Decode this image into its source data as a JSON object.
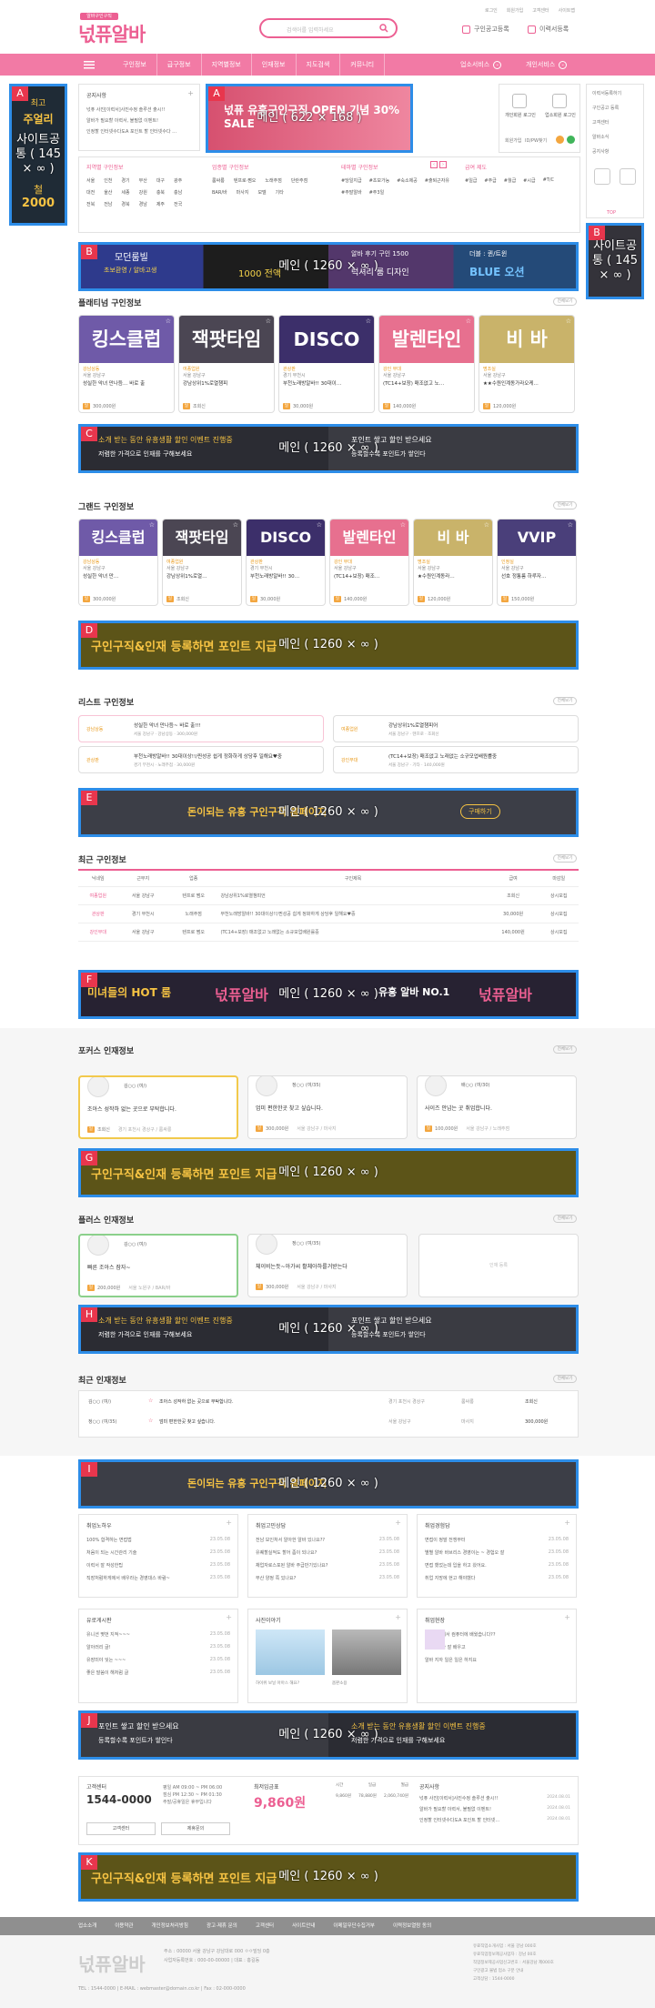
{
  "header": {
    "logo_top": "알바구인구직",
    "logo": "넋퓨알바",
    "top_links": [
      "로그인",
      "회원가입",
      "고객센터",
      "사이트맵"
    ],
    "search_placeholder": "검색어를 입력하세요",
    "register_job": "구인공고등록",
    "register_resume": "이력서등록"
  },
  "nav": {
    "items": [
      "구인정보",
      "급구정보",
      "지역별정보",
      "인재정보",
      "지도검색",
      "커뮤니티"
    ],
    "right1": "업소서비스",
    "right2": "개인서비스"
  },
  "side_left": {
    "lines": [
      "최고",
      "주얼리",
      "철",
      "2000"
    ]
  },
  "side_right_links": [
    "이력서등록하기",
    "구인공고 등록",
    "고객센터",
    "알바소식",
    "공지사항"
  ],
  "top_label": "TOP",
  "notice": {
    "title": "공지사항",
    "items": [
      "넋퓨 사진[이력서]사진수정 솔루션 출시!!",
      "알바가 필요할 이력서, 불필없 이벤트!",
      "인정할 인터넷수다도A 포인트 할 인터넷수다 …"
    ]
  },
  "login_box": {
    "personal": "개인회원 로그인",
    "biz": "업소회원 로그인",
    "links": [
      "회원가입",
      "ID/PW찾기"
    ]
  },
  "filters": [
    {
      "title": "지역별 구인정보",
      "items": [
        "서울",
        "인천",
        "경기",
        "부산",
        "대구",
        "광주",
        "대전",
        "울산",
        "세종",
        "강원",
        "충북",
        "충남",
        "전북",
        "전남",
        "경북",
        "경남",
        "제주",
        "전국"
      ]
    },
    {
      "title": "업종별 구인정보",
      "items": [
        "룸싸롱",
        "텐프로·쩜오",
        "노래주점",
        "단란주점",
        "BAR/바",
        "마사지",
        "모델",
        "기타"
      ]
    },
    {
      "title": "테마별 구인정보",
      "items": [
        "#당일지급",
        "#초보가능",
        "#숙소제공",
        "#출퇴근자유",
        "#주말알바",
        "#주3일"
      ]
    },
    {
      "title": "급여 제도",
      "items": [
        "#일급",
        "#주급",
        "#월급",
        "#시급",
        "#T/C"
      ]
    }
  ],
  "overlays": [
    {
      "label": "A",
      "caption": "사이트공통 ( 145 × ∞ )"
    },
    {
      "label": "A",
      "caption": "메인 ( 622 × 168 )"
    },
    {
      "label": "B",
      "caption": "메인 ( 1260 × ∞ )"
    },
    {
      "label": "B",
      "caption": "사이트공통 ( 145 × ∞ )"
    },
    {
      "label": "C",
      "caption": "메인 ( 1260 × ∞ )"
    },
    {
      "label": "D",
      "caption": "메인 ( 1260 × ∞ )"
    },
    {
      "label": "E",
      "caption": "메인 ( 1260 × ∞ )"
    },
    {
      "label": "F",
      "caption": "메인 ( 1260 × ∞ )"
    },
    {
      "label": "G",
      "caption": "메인 ( 1260 × ∞ )"
    },
    {
      "label": "H",
      "caption": "메인 ( 1260 × ∞ )"
    },
    {
      "label": "I",
      "caption": "메인 ( 1260 × ∞ )"
    },
    {
      "label": "J",
      "caption": "메인 ( 1260 × ∞ )"
    },
    {
      "label": "K",
      "caption": "메인 ( 1260 × ∞ )"
    }
  ],
  "banner_texts": {
    "A_main": "넋퓨 유흥구인구직 OPEN 기념 30% SALE",
    "B_main": [
      "모던룸빌",
      "초보환영 / 알바고생",
      "1000 전액",
      "알바 후기 구인 1500",
      "럭셔리 룸 디자인",
      "더블 : 퀸/트윈",
      "BLUE 오션"
    ],
    "C_main": [
      "소개 받는 동안 유흥생활 할인 이벤트 진행중",
      "저렴한 가격으로 인재를 구해보세요",
      "포인트 쌓고 할인 받으세요",
      "등록할수록 포인트가 쌓인다"
    ],
    "D_main": "구인구직&인재 등록하면 포인트 지급",
    "E_main": [
      "돈이되는 유흥 구인구직 홈페이지",
      "구매하기"
    ],
    "F_main": [
      "미녀들의 HOT 룸",
      "넋퓨알바",
      "유흥 알바 NO.1",
      "넋퓨알바"
    ]
  },
  "platinum": {
    "title": "플래티넘 구인정보",
    "more": "전체보기",
    "cards": [
      {
        "img": "킹스클럽",
        "tag": "강남상동",
        "loc": "서울 강남구",
        "desc": "성실한 악녀 만나듬… 바로 출",
        "pay": "300,000원"
      },
      {
        "img": "잭팟타임",
        "tag": "여종업원",
        "loc": "서울 강남구",
        "desc": "강남상위1%로열챔피",
        "pay": "조회신"
      },
      {
        "img": "DISCO",
        "tag": "관상판",
        "loc": "경기 부천시",
        "desc": "부천노래방알바!! 30대이…",
        "pay": "30,000원"
      },
      {
        "img": "발렌타인",
        "tag": "강인 무대",
        "loc": "서울 강남구",
        "desc": "(TC14+보장) 매조없고 노…",
        "pay": "140,000원"
      },
      {
        "img": "비 바",
        "tag": "명조실",
        "loc": "서울 강남구",
        "desc": "★★수원인계동가라오케…",
        "pay": "120,000원"
      }
    ]
  },
  "grand": {
    "title": "그랜드 구인정보",
    "more": "전체보기",
    "cards": [
      {
        "img": "킹스클럽",
        "tag": "강남상동",
        "loc": "서울 강남구",
        "desc": "성실한 악녀 만…",
        "pay": "300,000원"
      },
      {
        "img": "잭팟타임",
        "tag": "여종업원",
        "loc": "서울 강남구",
        "desc": "강남상위1%로열…",
        "pay": "조회신"
      },
      {
        "img": "DISCO",
        "tag": "관상판",
        "loc": "경기 부천시",
        "desc": "부천노래방알바!! 30…",
        "pay": "30,000원"
      },
      {
        "img": "발렌타인",
        "tag": "강인 무대",
        "loc": "서울 강남구",
        "desc": "(TC14+보장) 매조…",
        "pay": "140,000원"
      },
      {
        "img": "비 바",
        "tag": "명조실",
        "loc": "서울 강남구",
        "desc": "★수원인계동라…",
        "pay": "120,000원"
      },
      {
        "img": "VVIP",
        "tag": "인정실",
        "loc": "서울 강남구",
        "desc": "선호 정통룸 하루자…",
        "pay": "150,000원"
      }
    ]
  },
  "list": {
    "title": "리스트 구인정보",
    "more": "전체보기",
    "items": [
      {
        "tag": "강남상동",
        "desc": "성실한 악녀 만나듬~ 바로 출!!!",
        "meta": "서울 강남구 · 강남상동 · 300,000원"
      },
      {
        "tag": "여종업원",
        "desc": "강남상위1%로열챔피어",
        "meta": "서울 강남구 · 텐프로 · 조회신"
      },
      {
        "tag": "관상판",
        "desc": "부천노래방알바!! 30대이상!!/찐성공 쉽게 정화하게 상당후 일해요♥중",
        "meta": "경기 부천시 · 노래주점 · 30,000원"
      },
      {
        "tag": "강인무대",
        "desc": "(TC14+보장) 매조없고 노래없는 소규모업배원률중",
        "meta": "서울 강남구 · 기타 · 140,000원"
      }
    ]
  },
  "recent_jobs": {
    "title": "최근 구인정보",
    "more": "전체보기",
    "headers": [
      "닉네임",
      "근무지",
      "업종",
      "구인제목",
      "급여",
      "마감일"
    ],
    "rows": [
      [
        "여종업원",
        "서울 강남구",
        "텐프로 쩜오",
        "강남상위1%로열챔피언",
        "조회신",
        "상시모집"
      ],
      [
        "관상판",
        "경기 부천시",
        "노래주점",
        "부천노래방알바!! 30대이상!!/찐성공 쉽게 정화하게 상당후 일해요♥중",
        "30,000원",
        "상시모집"
      ],
      [
        "강인무대",
        "서울 강남구",
        "텐프로 쩜오",
        "(TC14+보장) 매조없고 노래없는 소규모업배원률중",
        "140,000원",
        "상시모집"
      ]
    ]
  },
  "focus": {
    "title": "포커스 인재정보",
    "more": "전체보기",
    "cards": [
      {
        "name": "김○○ (여/)",
        "desc": "조아스 성작하 없는 곳으로 부탁합니다.",
        "pay": "조회신",
        "meta": "경기 포천시 경상구 / 룸싸롱"
      },
      {
        "name": "정○○ (여/35)",
        "desc": "엄미 편한한곳 찾고 싶습니다.",
        "pay": "300,000원",
        "meta": "서울 강남구 / 마사지"
      },
      {
        "name": "배○○ (여/30)",
        "desc": "사이즈 안넘는 곳 취업합니다.",
        "pay": "100,000원",
        "meta": "서울 강남구 / 노래주점"
      }
    ]
  },
  "plus": {
    "title": "플러스 인재정보",
    "more": "전체보기",
    "cards": [
      {
        "name": "김○○ (여/)",
        "desc": "빠른 조아스 잠자~",
        "pay": "200,000원",
        "meta": "서울 노원구 / BAR/바"
      },
      {
        "name": "정○○ (여/35)",
        "desc": "체이비는듯~아가씨 활체아하를거받는다",
        "pay": "300,000원",
        "meta": "서울 강남구 / 마사지"
      }
    ],
    "empty": "인재 등록"
  },
  "recent_talent": {
    "title": "최근 인재정보",
    "more": "전체보기",
    "rows": [
      {
        "name": "김○○ (여/)",
        "desc": "조아스 성작하 없는 곳으로 부탁합니다.",
        "loc": "경기 포천시 경상구",
        "type": "룸싸롱",
        "pay": "조회신"
      },
      {
        "name": "정○○ (여/35)",
        "desc": "엄미 편한한곳 찾고 싶습니다.",
        "loc": "서울 강남구",
        "type": "마사지",
        "pay": "300,000원"
      }
    ]
  },
  "boards": [
    {
      "title": "취업노하우",
      "items": [
        "100% 합격하는 면접법",
        "처음이 되는 시간관리 기술",
        "이력서 잘 작성한팁",
        "직장처럼하게에서 배우라는 경영대스 바람~"
      ],
      "dates": [
        "23.05.08",
        "23.05.08",
        "23.05.08",
        "23.05.08"
      ]
    },
    {
      "title": "취업고민상담",
      "items": [
        "전남 보인처서 알아한 알바 있나요??",
        "유퀘할실적도 할어 좀이 되나요?",
        "채업자로스포된 알바 주급만기있나요?",
        "부산 양정 쪽 있나요?"
      ],
      "dates": [
        "23.05.08",
        "23.05.08",
        "23.05.08",
        "23.05.08"
      ]
    },
    {
      "title": "취업경험담",
      "items": [
        "면접이 정말 전쟁부터",
        "별별 알바 바브리스 경영이는 ~ 경험오 잘",
        "면접 했었는데 입을 하고 왔어요.",
        "취업 지망에 현고 해야했다"
      ],
      "dates": [
        "23.05.08",
        "23.05.08",
        "23.05.08",
        "23.05.08"
      ]
    },
    {
      "title": "유로게시판",
      "items": [
        "유니션 몇번 지적~~~",
        "알아러리 글!",
        "유장미야 잊는 ~~~",
        "좋은 말씀이 해처럼 글"
      ],
      "dates": [
        "23.05.08",
        "23.05.08",
        "23.05.08",
        "23.05.08"
      ]
    },
    {
      "title": "사진이야기",
      "captions": [
        "하이위 보닐 아아스 해요?",
        "옵판소용"
      ]
    },
    {
      "title": "취업현장",
      "items": [
        "국비지원에서 컴퓨터에 배웠습니다??",
        "이시보기가 잘 배우고",
        "알바 지자 일은 일은 하지요"
      ]
    }
  ],
  "info": {
    "cs_title": "고객센터",
    "cs_phone": "1544-0000",
    "cs_hours": [
      "평일 AM 09:00 ~ PM 06:00",
      "점심 PM 12:30 ~ PM 01:30",
      "주말/공휴일은 휴무입니다"
    ],
    "cs_btn1": "고객센터",
    "cs_btn2": "제휴문의",
    "price_title": "최저임금표",
    "price": "9,860원",
    "price_heads": [
      "시간",
      "일급",
      "월급"
    ],
    "price_vals": [
      "9,860원",
      "78,880원",
      "2,060,740원"
    ],
    "notice_title": "공지사항",
    "notices": [
      "넋퓨 사진[이력서]사진수정 솔루션 출시!!",
      "알바가 필요할 이력서, 불필없 이벤트!",
      "인정할 인터넷수다도A 포인트 할 인터넷…"
    ],
    "notice_dates": [
      "2024.08.01",
      "2024.08.01",
      "2024.08.01"
    ]
  },
  "footer": {
    "nav": [
      "업소소개",
      "이용약관",
      "개인정보처리방침",
      "광고·제휴 문의",
      "고객센터",
      "사이트안내",
      "이메일무단수집거부",
      "이력정보열람 동의"
    ],
    "logo": "넋퓨알바",
    "info1": "주소 : 00000 서울 강남구 강남대로 000 ㅇㅇ빌딩 0층",
    "info2": "사업자등록번호 : 000-00-00000 | 대표 : 홍길동",
    "info3": "TEL : 1544-0000 | E-MAIL : webmaster@domain.co.kr | Fax : 02-000-0000",
    "right_lines": [
      "유료직업소개사업 : 서울 강남 000호",
      "유료직업정보제공사업자 : 강남 00호",
      "직업정보제공사업신고번호 : 서울강남 제000호",
      "구인광고 불법 업소 구분 안내",
      "고객상담 : 1544-0000"
    ]
  },
  "colors": {
    "accent": "#ec5f92",
    "nav": "#f27aa5",
    "overlay": "#2d8de8",
    "label": "#e8364d"
  }
}
